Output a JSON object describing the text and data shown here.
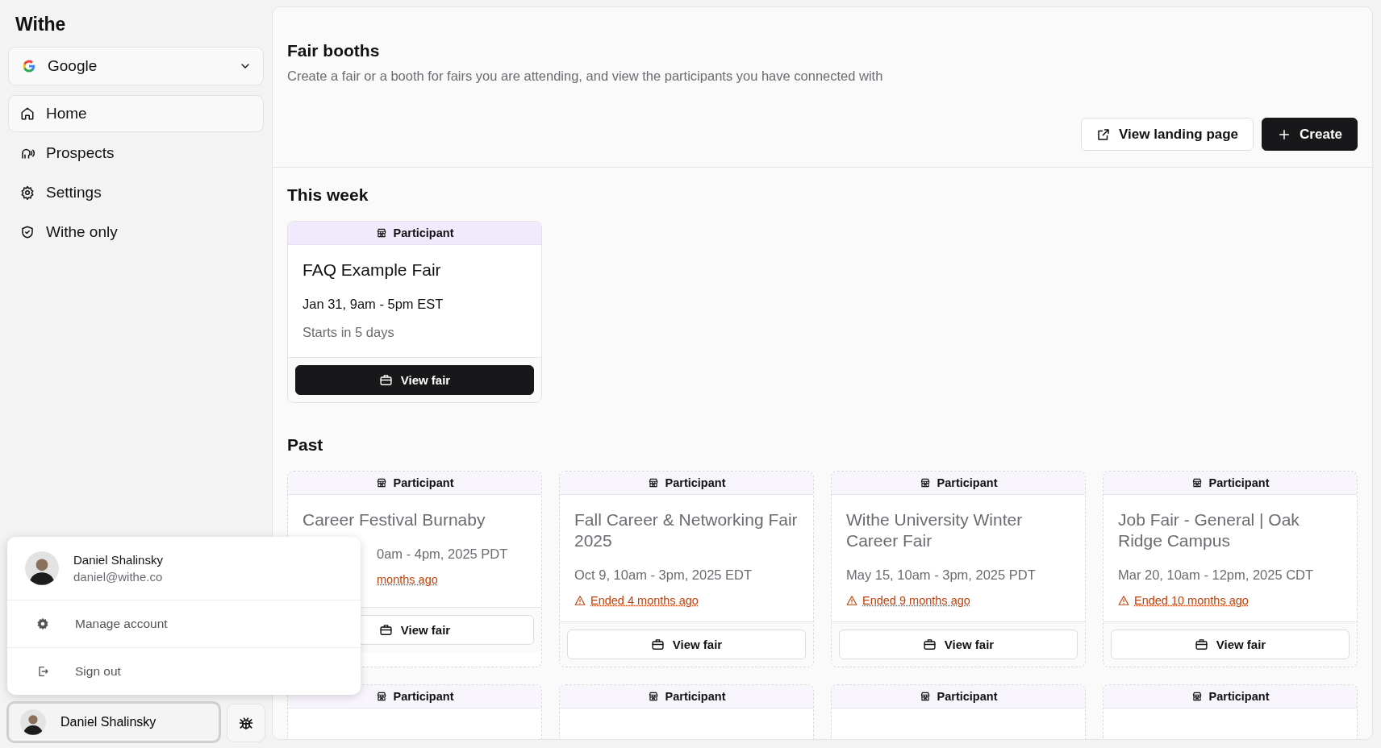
{
  "sidebar": {
    "brand": "Withe",
    "workspace": {
      "name": "Google"
    },
    "items": [
      {
        "label": "Home",
        "selected": true
      },
      {
        "label": "Prospects",
        "selected": false
      },
      {
        "label": "Settings",
        "selected": false
      },
      {
        "label": "Withe only",
        "selected": false
      }
    ]
  },
  "account_menu": {
    "name": "Daniel Shalinsky",
    "email": "daniel@withe.co",
    "items": [
      {
        "label": "Manage account"
      },
      {
        "label": "Sign out"
      }
    ]
  },
  "user_button": {
    "name": "Daniel Shalinsky"
  },
  "page": {
    "title": "Fair booths",
    "subtitle": "Create a fair or a booth for fairs you are attending, and view the participants you have connected with",
    "actions": [
      {
        "label": "View landing page",
        "kind": "secondary"
      },
      {
        "label": "Create",
        "kind": "primary"
      }
    ]
  },
  "sections": [
    {
      "title": "This week",
      "fairs": [
        {
          "badge": "Participant",
          "kind": "upcoming",
          "title": "FAQ Example Fair",
          "date": "Jan 31, 9am - 5pm EST",
          "status": "Starts in 5 days",
          "action": "View fair"
        }
      ]
    },
    {
      "title": "Past",
      "fairs": [
        {
          "badge": "Participant",
          "kind": "ended",
          "covered": true,
          "title": "Career Festival Burnaby",
          "date": "0am - 4pm, 2025 PDT",
          "status": "months ago",
          "action": "View fair"
        },
        {
          "badge": "Participant",
          "kind": "ended",
          "covered": false,
          "title": "Fall Career & Networking Fair 2025",
          "date": "Oct 9, 10am - 3pm, 2025 EDT",
          "status": "Ended 4 months ago",
          "action": "View fair"
        },
        {
          "badge": "Participant",
          "kind": "ended",
          "covered": false,
          "title": "Withe University Winter Career Fair",
          "date": "May 15, 10am - 3pm, 2025 PDT",
          "status": "Ended 9 months ago",
          "action": "View fair"
        },
        {
          "badge": "Participant",
          "kind": "ended",
          "covered": false,
          "title": "Job Fair - General | Oak Ridge Campus",
          "date": "Mar 20, 10am - 12pm, 2025 CDT",
          "status": "Ended 10 months ago",
          "action": "View fair"
        },
        {
          "badge": "Participant",
          "kind": "ended"
        },
        {
          "badge": "Participant",
          "kind": "ended"
        },
        {
          "badge": "Participant",
          "kind": "ended"
        },
        {
          "badge": "Participant",
          "kind": "ended"
        }
      ]
    }
  ]
}
